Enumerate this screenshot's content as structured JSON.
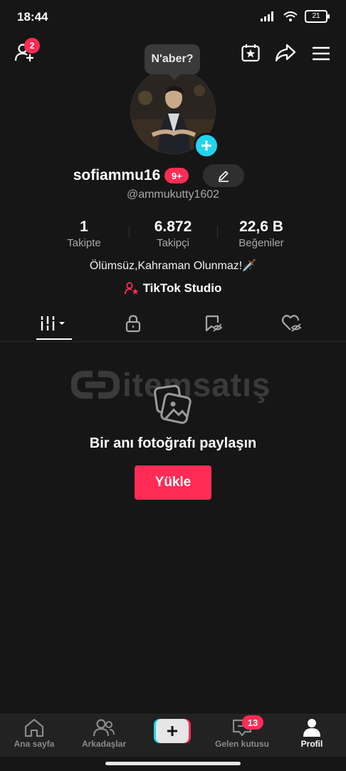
{
  "status_bar": {
    "time": "18:44",
    "battery": "21"
  },
  "top_bar": {
    "friends_badge": "2",
    "tooltip": "N'aber?"
  },
  "profile": {
    "username": "sofiammu16",
    "username_badge": "9+",
    "handle": "@ammukutty1602",
    "bio": "Ölümsüz,Kahraman Olunmaz!🗡️",
    "studio_link": "TikTok Studio"
  },
  "stats": [
    {
      "value": "1",
      "label": "Takipte"
    },
    {
      "value": "6.872",
      "label": "Takipçi"
    },
    {
      "value": "22,6 B",
      "label": "Beğeniler"
    }
  ],
  "watermark": "itemsatış",
  "empty_state": {
    "title": "Bir anı fotoğrafı paylaşın",
    "button": "Yükle"
  },
  "bottom_nav": {
    "home": "Ana sayfa",
    "friends": "Arkadaşlar",
    "inbox": "Gelen kutusu",
    "inbox_badge": "13",
    "profile": "Profil"
  },
  "colors": {
    "accent": "#fe2c55",
    "cyan": "#20d5ec",
    "background": "#161616"
  }
}
